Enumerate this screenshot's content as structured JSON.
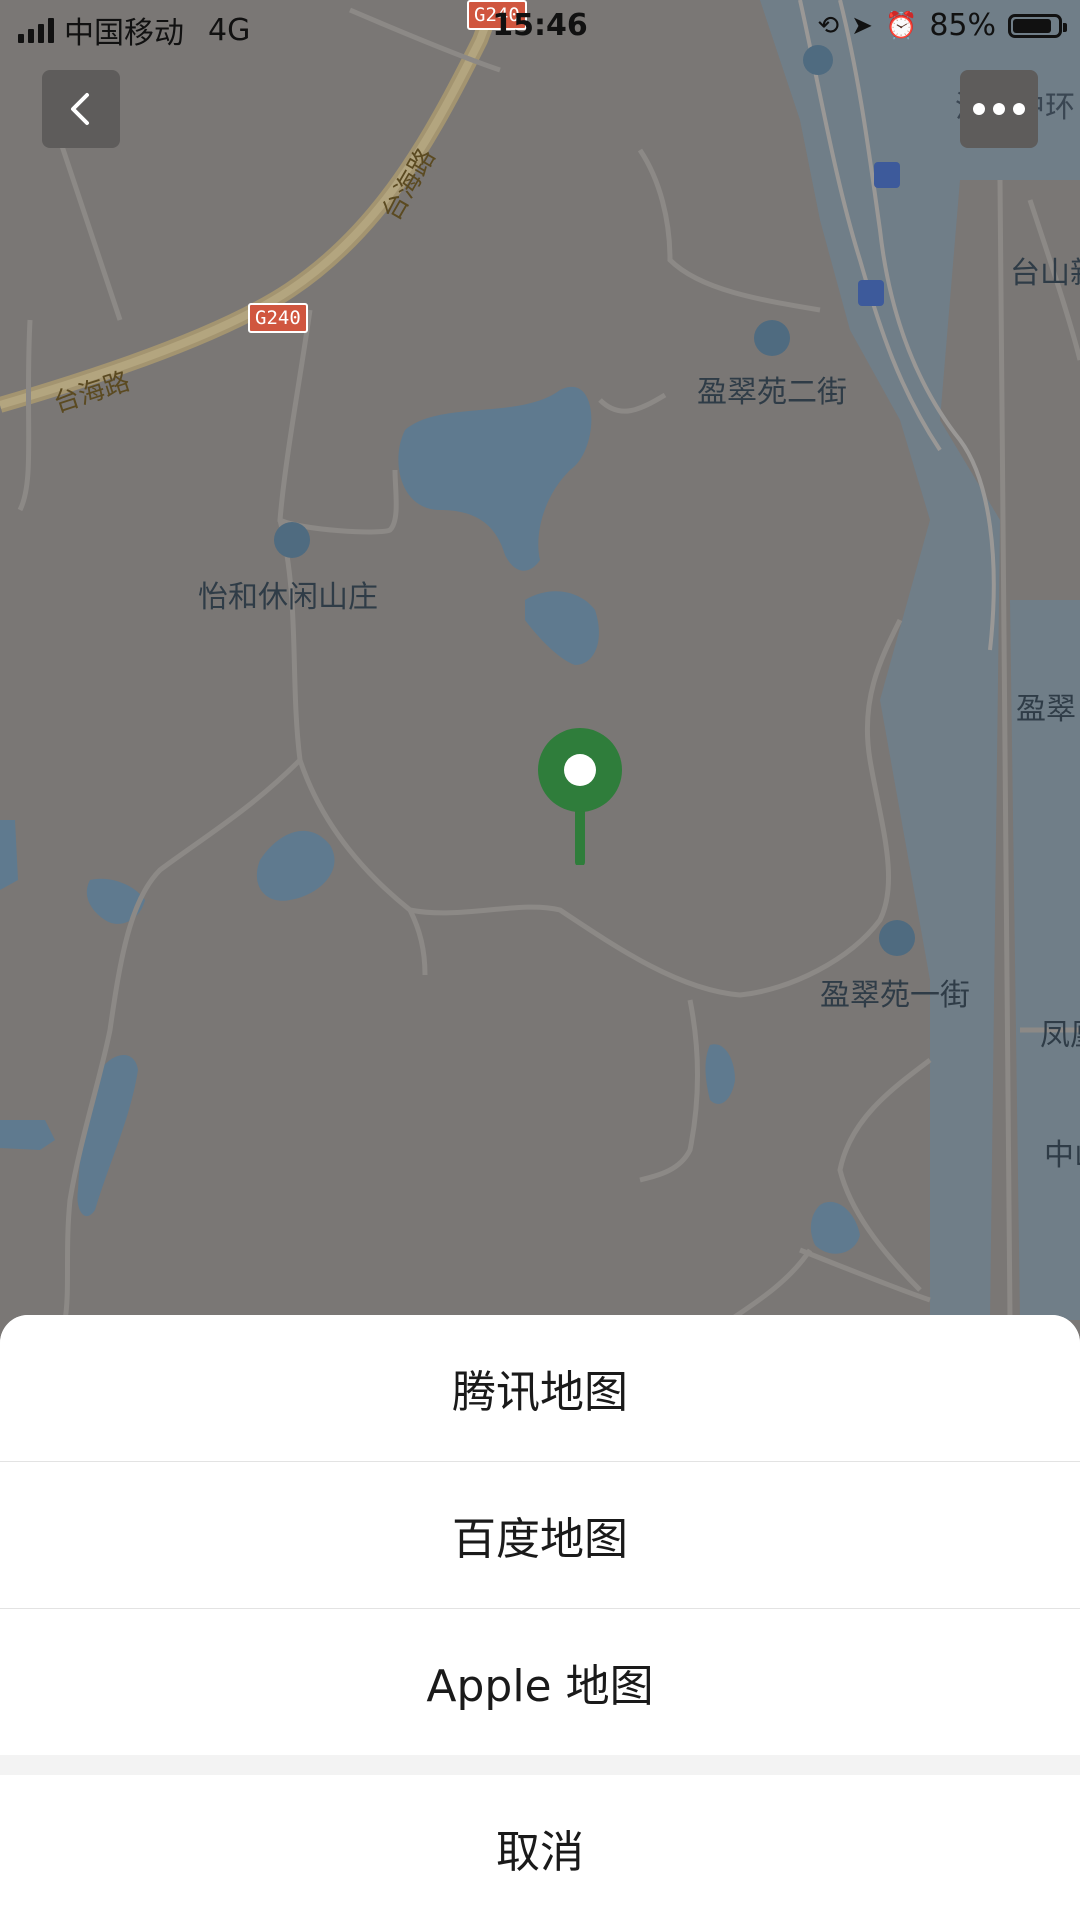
{
  "status_bar": {
    "carrier": "中国移动",
    "network": "4G",
    "time": "15:46",
    "battery": "85%"
  },
  "map": {
    "labels": {
      "taihai_road_1": "台海路",
      "taihai_road_2": "台海路",
      "g240_1": "G240",
      "g240_2": "G240",
      "yingcui_2": "盈翠苑二街",
      "yihe": "怡和休闲山庄",
      "yingcui_1": "盈翠苑一街",
      "taishan": "台山新",
      "ying": "盈翠",
      "feng": "凤凰",
      "zhong": "中山",
      "wohua": "沃华中环"
    },
    "colors": {
      "land": "#7a7775",
      "water": "#5f7a8f",
      "road": "#8c8986",
      "highway": "#a39470",
      "pin": "#2f7d3b"
    }
  },
  "sheet": {
    "items": [
      "腾讯地图",
      "百度地图",
      "Apple 地图"
    ],
    "cancel": "取消"
  },
  "icons": {
    "back": "chevron-left-icon",
    "more": "more-dots-icon",
    "pin": "location-pin-icon"
  }
}
